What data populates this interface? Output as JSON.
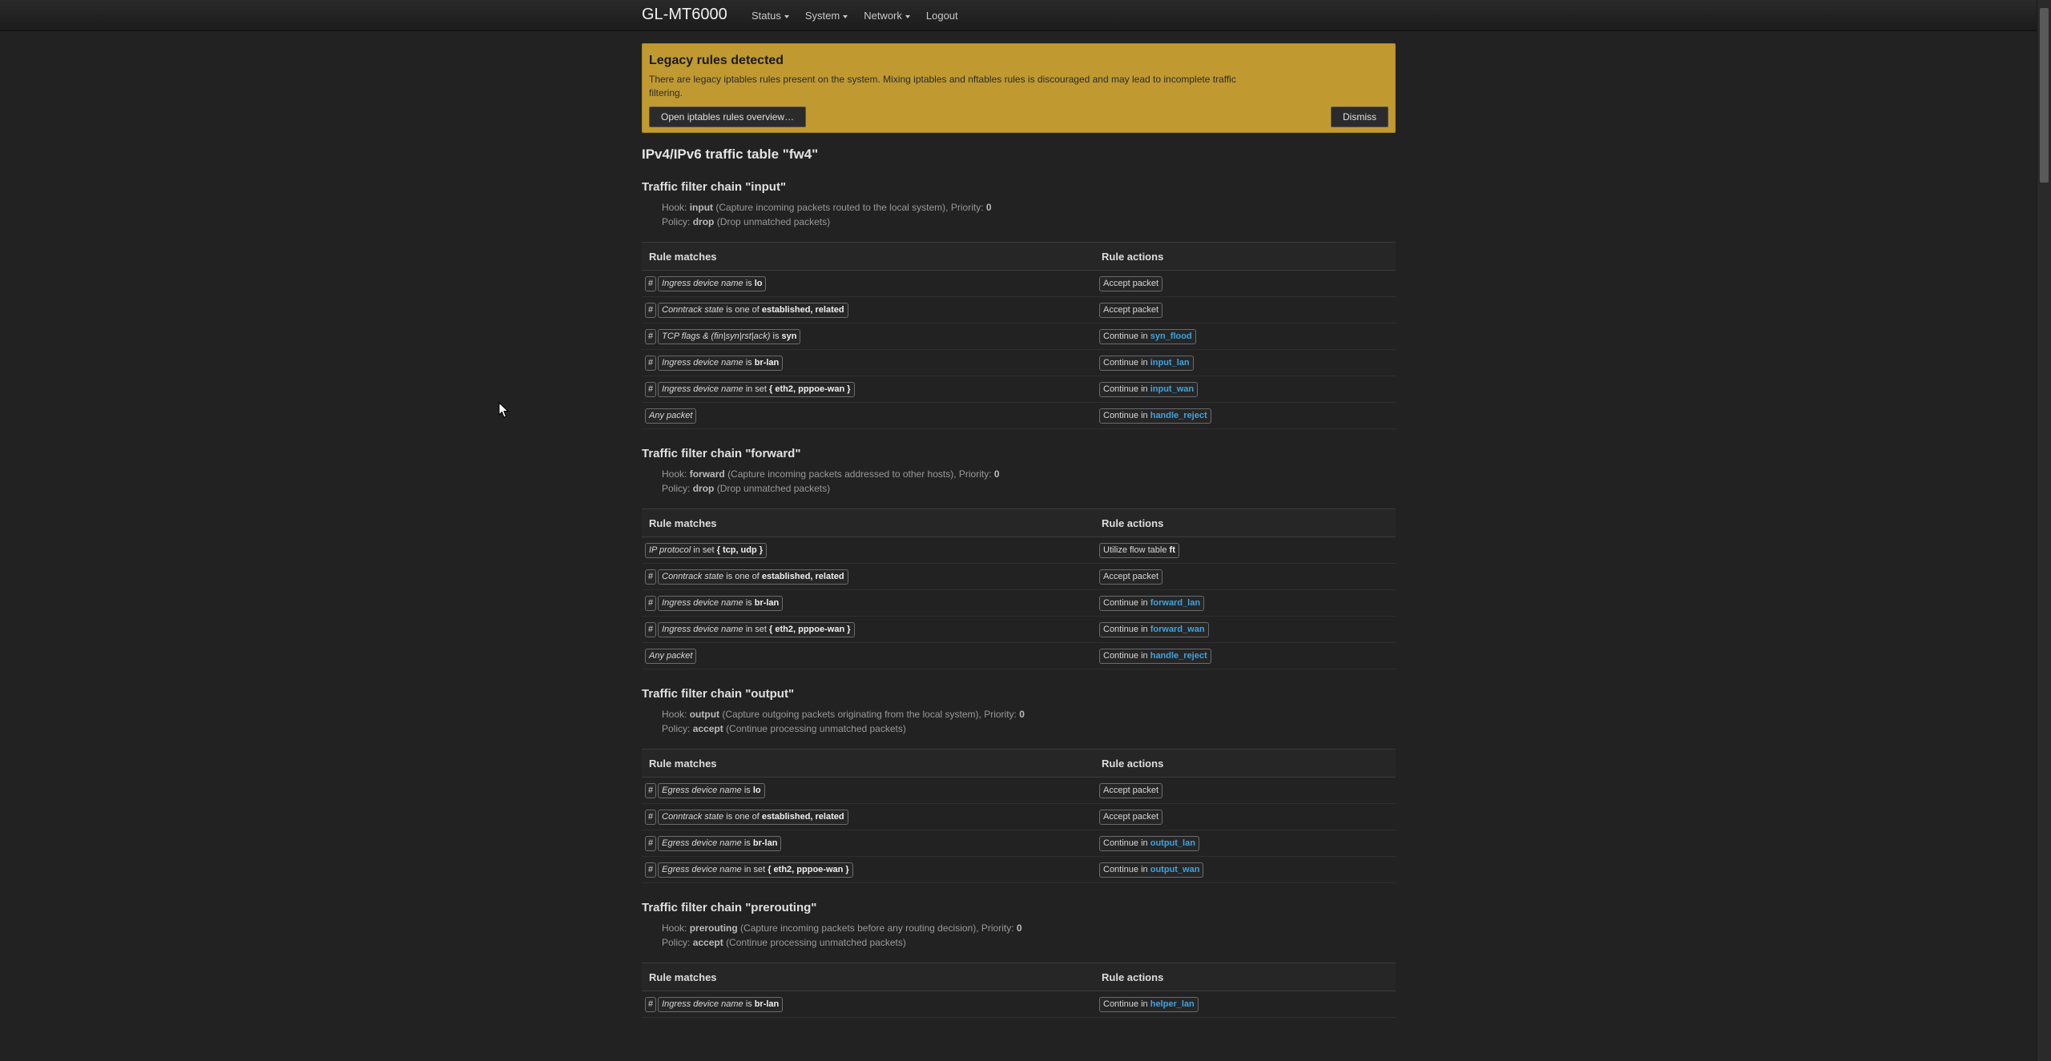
{
  "brand": "GL-MT6000",
  "nav": [
    {
      "label": "Status",
      "dropdown": true
    },
    {
      "label": "System",
      "dropdown": true
    },
    {
      "label": "Network",
      "dropdown": true
    },
    {
      "label": "Logout",
      "dropdown": false
    }
  ],
  "alert": {
    "title": "Legacy rules detected",
    "text": "There are legacy iptables rules present on the system. Mixing iptables and nftables rules is discouraged and may lead to incomplete traffic filtering.",
    "open_button": "Open iptables rules overview…",
    "dismiss_button": "Dismiss"
  },
  "table_title": "IPv4/IPv6 traffic table \"fw4\"",
  "columns": {
    "matches": "Rule matches",
    "actions": "Rule actions"
  },
  "labels": {
    "hook": "Hook:",
    "policy": "Policy:",
    "priority": "Priority:",
    "hash": "#",
    "any_packet": "Any packet",
    "accept_packet": "Accept packet",
    "continue_in": "Continue in",
    "utilize_flow": "Utilize flow table"
  },
  "chains": [
    {
      "title": "Traffic filter chain \"input\"",
      "hook": "input",
      "hook_desc": "(Capture incoming packets routed to the local system),",
      "priority": "0",
      "policy": "drop",
      "policy_desc": "(Drop unmatched packets)",
      "rules": [
        {
          "hash": true,
          "field": "Ingress device name",
          "op": "is",
          "value": "lo",
          "action": "accept"
        },
        {
          "hash": true,
          "field": "Conntrack state",
          "op": "is one of",
          "value": "established, related",
          "action": "accept"
        },
        {
          "hash": true,
          "field": "TCP flags & (fin|syn|rst|ack)",
          "op": "is",
          "value": "syn",
          "action": "continue",
          "target": "syn_flood"
        },
        {
          "hash": true,
          "field": "Ingress device name",
          "op": "is",
          "value": "br-lan",
          "action": "continue",
          "target": "input_lan"
        },
        {
          "hash": true,
          "field": "Ingress device name",
          "op": "in set",
          "value": "{ eth2, pppoe-wan }",
          "action": "continue",
          "target": "input_wan"
        },
        {
          "any": true,
          "action": "continue",
          "target": "handle_reject"
        }
      ]
    },
    {
      "title": "Traffic filter chain \"forward\"",
      "hook": "forward",
      "hook_desc": "(Capture incoming packets addressed to other hosts),",
      "priority": "0",
      "policy": "drop",
      "policy_desc": "(Drop unmatched packets)",
      "rules": [
        {
          "hash": false,
          "field": "IP protocol",
          "op": "in set",
          "value": "{ tcp, udp }",
          "action": "flow",
          "target": "ft"
        },
        {
          "hash": true,
          "field": "Conntrack state",
          "op": "is one of",
          "value": "established, related",
          "action": "accept"
        },
        {
          "hash": true,
          "field": "Ingress device name",
          "op": "is",
          "value": "br-lan",
          "action": "continue",
          "target": "forward_lan"
        },
        {
          "hash": true,
          "field": "Ingress device name",
          "op": "in set",
          "value": "{ eth2, pppoe-wan }",
          "action": "continue",
          "target": "forward_wan"
        },
        {
          "any": true,
          "action": "continue",
          "target": "handle_reject"
        }
      ]
    },
    {
      "title": "Traffic filter chain \"output\"",
      "hook": "output",
      "hook_desc": "(Capture outgoing packets originating from the local system),",
      "priority": "0",
      "policy": "accept",
      "policy_desc": "(Continue processing unmatched packets)",
      "rules": [
        {
          "hash": true,
          "field": "Egress device name",
          "op": "is",
          "value": "lo",
          "action": "accept"
        },
        {
          "hash": true,
          "field": "Conntrack state",
          "op": "is one of",
          "value": "established, related",
          "action": "accept"
        },
        {
          "hash": true,
          "field": "Egress device name",
          "op": "is",
          "value": "br-lan",
          "action": "continue",
          "target": "output_lan"
        },
        {
          "hash": true,
          "field": "Egress device name",
          "op": "in set",
          "value": "{ eth2, pppoe-wan }",
          "action": "continue",
          "target": "output_wan"
        }
      ]
    },
    {
      "title": "Traffic filter chain \"prerouting\"",
      "hook": "prerouting",
      "hook_desc": "(Capture incoming packets before any routing decision),",
      "priority": "0",
      "policy": "accept",
      "policy_desc": "(Continue processing unmatched packets)",
      "rules": [
        {
          "hash": true,
          "field": "Ingress device name",
          "op": "is",
          "value": "br-lan",
          "action": "continue",
          "target": "helper_lan"
        }
      ]
    }
  ]
}
